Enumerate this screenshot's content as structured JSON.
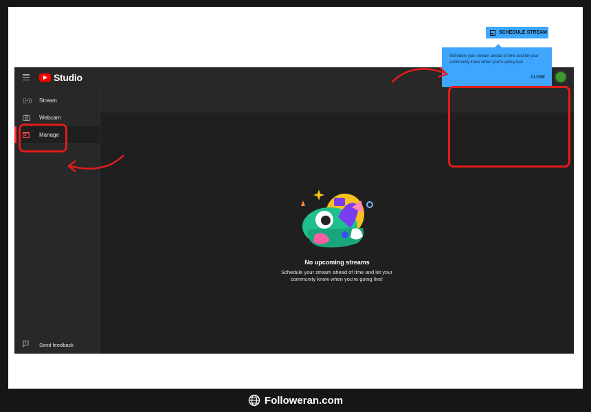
{
  "app": {
    "logo_text": "Studio",
    "brand_color": "#ff0000",
    "accent_color": "#3ea6ff"
  },
  "sidebar": {
    "items": [
      {
        "label": "Stream",
        "icon": "broadcast-icon"
      },
      {
        "label": "Webcam",
        "icon": "camera-icon"
      },
      {
        "label": "Manage",
        "icon": "calendar-icon",
        "active": true
      }
    ],
    "feedback_label": "Send feedback"
  },
  "header": {
    "schedule_button": "SCHEDULE STREAM"
  },
  "tooltip": {
    "text": "Schedule your stream ahead of time and let your community know when you're going live!",
    "close_label": "CLOSE"
  },
  "empty_state": {
    "title": "No upcoming streams",
    "description": "Schedule your stream ahead of time and let your community know when you're going live!"
  },
  "watermark": {
    "text": "Followeran.com"
  }
}
